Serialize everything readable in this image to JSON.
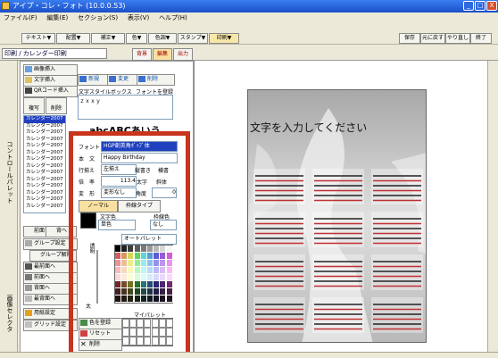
{
  "window": {
    "title": "アイプ・コレ・フォト  (10.0.0.53)",
    "min": "_",
    "max": "□",
    "close": "X"
  },
  "menu": [
    "ファイル(F)",
    "編集(E)",
    "セクション(S)",
    "表示(V)",
    "ヘルプ(H)"
  ],
  "toolbar": {
    "items": [
      "テキスト▼",
      "配置▼",
      "補正▼",
      "色▼",
      "色調▼",
      "スタンプ▼",
      "印刷▼"
    ],
    "right": [
      "保存",
      "元に戻す",
      "やり直し",
      "終了"
    ]
  },
  "doc_title": "印刷 / カレンダー印刷",
  "tabs": [
    "背景",
    "編集",
    "出力"
  ],
  "left_strip": {
    "top": "コントロールパレット",
    "bottom": "画像セレクタ"
  },
  "panel": {
    "buttons": [
      "画像挿入",
      "文字挿入",
      "QRコード挿入",
      "複写",
      "削除"
    ],
    "style_buttons": [
      "新規",
      "変更",
      "削除"
    ],
    "style_label": "文字スタイルボックス",
    "font_checkbox": "フォントを登録",
    "preview_value": "ｚｘｘｙ",
    "sample_text": "abcABCあいう",
    "list_items": [
      "カレンダー2007",
      "カレンダー2007",
      "カレンダー2007",
      "カレンダー2007",
      "カレンダー2007",
      "カレンダー2007",
      "カレンダー2007",
      "カレンダー2007",
      "カレンダー2007",
      "カレンダー2007",
      "カレンダー2007",
      "カレンダー2007",
      "カレンダー2007",
      "カレンダー2007"
    ],
    "font_label": "フォント",
    "font_value": "HGP創英角ﾎﾟｯﾌﾟ体",
    "text_label": "本　文",
    "text_value": "Happy Birthday",
    "align_label": "行揃え",
    "align_value": "左揃え",
    "vertical": "縦書き",
    "horizontal": "横書",
    "size_label": "倍　率",
    "size_value": "113.4",
    "bold": "太字",
    "italic": "斜体",
    "deco_label": "変　形",
    "deco_value": "変形なし",
    "angle_label": "角度",
    "angle_value": "0",
    "sort_buttons": [
      "前面",
      "背へ"
    ],
    "group_button": "グループ設定",
    "group_release": "グループ解除",
    "order_buttons": [
      "最前面へ",
      "前面へ",
      "背面へ",
      "最背面へ"
    ],
    "layout_button": "用紙設定",
    "grid_button": "グリッド設定",
    "tabs2": [
      "ノーマル",
      "枠線タイプ"
    ],
    "color_label": "文字色",
    "color_value": "単色",
    "border_label": "枠線色",
    "border_value": "なし",
    "palette_mode": "オートパレット",
    "transparency_label": "透明",
    "thick_label": "太",
    "my_palette": "マイパレット",
    "register": "色を登録",
    "reset": "リセット",
    "delete": "削除"
  },
  "canvas": {
    "overlay_text": "文字を入力してください",
    "calendar_cells": 12
  },
  "colors": {
    "highlight": "#c8341c",
    "titlebar": "#2456d8",
    "accent": "#e5a020"
  }
}
